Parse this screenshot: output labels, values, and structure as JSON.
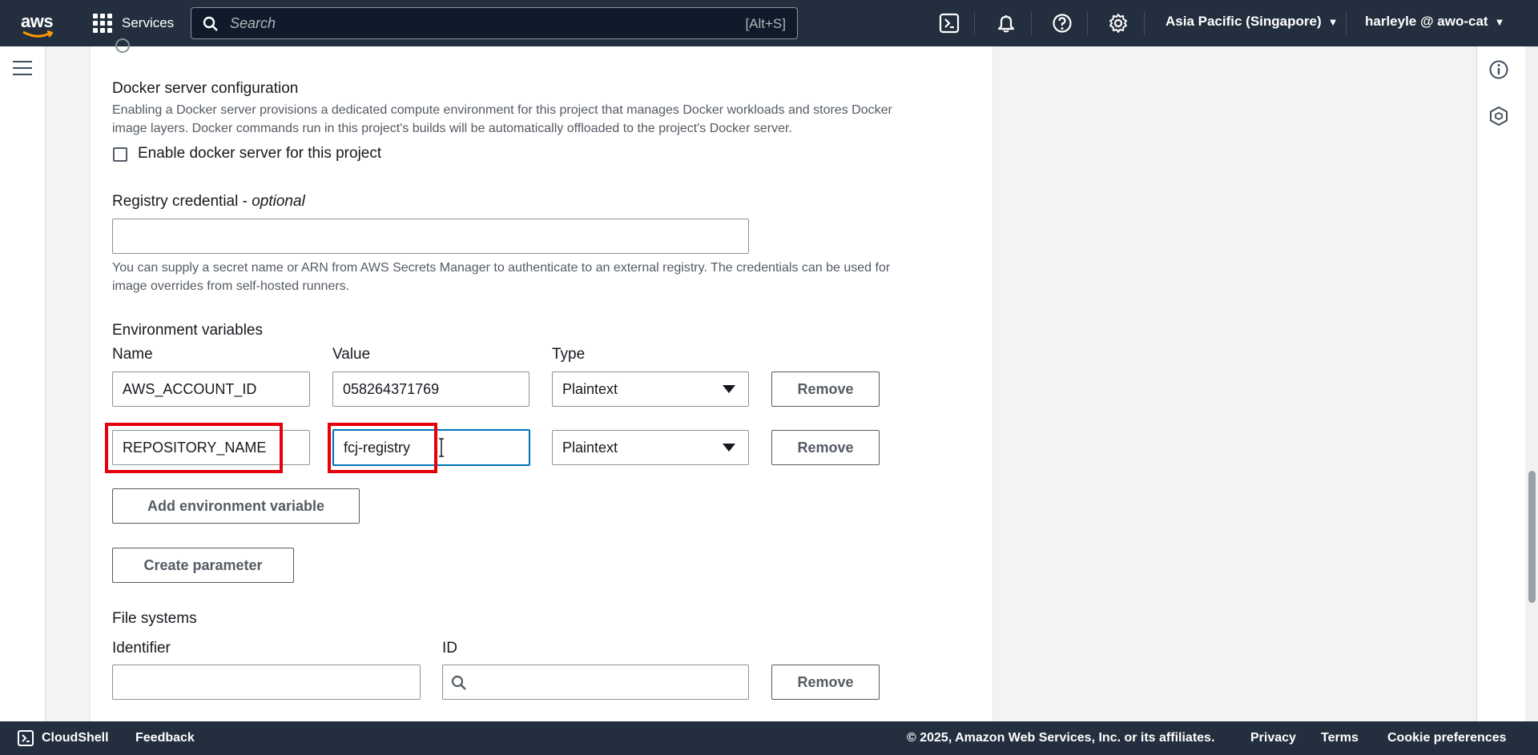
{
  "topbar": {
    "logo_text": "aws",
    "services_label": "Services",
    "search_placeholder": "Search",
    "search_shortcut": "[Alt+S]",
    "region_label": "Asia Pacific (Singapore)",
    "user_label": "harleyle @ awo-cat"
  },
  "docker": {
    "heading": "Docker server configuration",
    "description_line1": "Enabling a Docker server provisions a dedicated compute environment for this project that manages Docker workloads and stores Docker",
    "description_line2": "image layers. Docker commands run in this project's builds will be automatically offloaded to the project's Docker server.",
    "checkbox_label": "Enable docker server for this project",
    "checked": false
  },
  "registry": {
    "label": "Registry credential",
    "optional": "optional",
    "value": "",
    "help_line1": "You can supply a secret name or ARN from AWS Secrets Manager to authenticate to an external registry. The credentials can be used for",
    "help_line2": "image overrides from self-hosted runners."
  },
  "env": {
    "heading": "Environment variables",
    "col_name": "Name",
    "col_value": "Value",
    "col_type": "Type",
    "rows": [
      {
        "name": "AWS_ACCOUNT_ID",
        "value": "058264371769",
        "type": "Plaintext",
        "remove": "Remove"
      },
      {
        "name": "REPOSITORY_NAME",
        "value": "fcj-registry",
        "type": "Plaintext",
        "remove": "Remove"
      }
    ],
    "add_button": "Add environment variable",
    "create_param_button": "Create parameter"
  },
  "filesystems": {
    "heading": "File systems",
    "col_identifier": "Identifier",
    "col_id": "ID",
    "identifier_value": "",
    "id_value": "",
    "remove": "Remove"
  },
  "footer": {
    "cloudshell": "CloudShell",
    "feedback": "Feedback",
    "copyright": "© 2025, Amazon Web Services, Inc. or its affiliates.",
    "privacy": "Privacy",
    "terms": "Terms",
    "cookie": "Cookie preferences"
  },
  "colors": {
    "nav_bg": "#232f3e",
    "highlight": "#e5000b",
    "focus": "#0073bb"
  }
}
